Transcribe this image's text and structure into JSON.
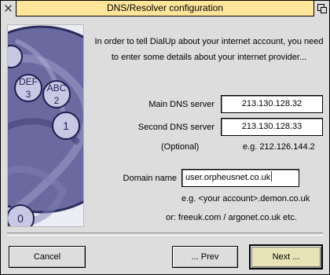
{
  "window": {
    "title": "DNS/Resolver configuration"
  },
  "intro_text": "In order to tell DialUp about your internet account, you need to enter some details about your internet provider...",
  "fields": {
    "main_dns": {
      "label": "Main DNS server",
      "value": "213.130.128.32"
    },
    "second_dns": {
      "label": "Second DNS server",
      "value": "213.130.128.33"
    },
    "optional_label": "(Optional)",
    "example_dns": "e.g. 212.126.144.2",
    "domain": {
      "label": "Domain name",
      "value": "user.orpheusnet.co.uk"
    },
    "domain_hint1": "e.g. <your account>.demon.co.uk",
    "domain_hint2": "or:  freeuk.com / argonet.co.uk etc."
  },
  "image_panel": {
    "keys": [
      {
        "digit": "1"
      },
      {
        "digit": "2",
        "letters": "ABC"
      },
      {
        "digit": "3",
        "letters": "DEF"
      },
      {
        "digit": "0"
      }
    ]
  },
  "buttons": {
    "cancel": "Cancel",
    "prev": "... Prev",
    "next": "Next ..."
  },
  "colors": {
    "title_bar": "#ffe59a",
    "window_bg": "#dddddd",
    "image_tint": "#4a4a8a",
    "caret": "#cc0000"
  }
}
